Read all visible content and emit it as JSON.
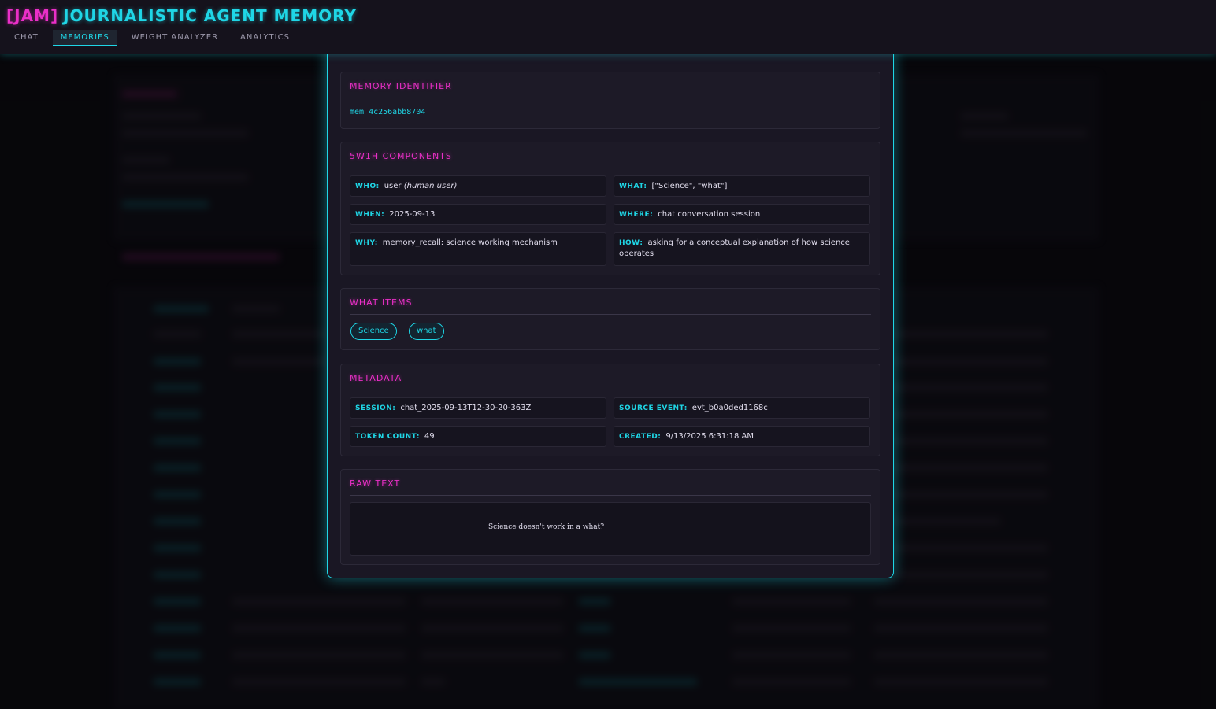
{
  "header": {
    "brand_tag": "[JAM]",
    "brand_name": "JOURNALISTIC AGENT MEMORY",
    "tabs": [
      {
        "label": "CHAT"
      },
      {
        "label": "MEMORIES"
      },
      {
        "label": "WEIGHT ANALYZER"
      },
      {
        "label": "ANALYTICS"
      }
    ],
    "active_tab": "MEMORIES"
  },
  "modal": {
    "identifier": {
      "title": "MEMORY IDENTIFIER",
      "value": "mem_4c256abb8704"
    },
    "components": {
      "title": "5W1H COMPONENTS",
      "who_label": "WHO:",
      "who_value": "user",
      "who_extra": "(human user)",
      "what_label": "WHAT:",
      "what_value": "[\"Science\", \"what\"]",
      "when_label": "WHEN:",
      "when_value": "2025-09-13",
      "where_label": "WHERE:",
      "where_value": "chat conversation session",
      "why_label": "WHY:",
      "why_value": "memory_recall: science working mechanism",
      "how_label": "HOW:",
      "how_value": "asking for a conceptual explanation of how science operates"
    },
    "what_items": {
      "title": "WHAT ITEMS",
      "items": [
        "Science",
        "what"
      ]
    },
    "metadata": {
      "title": "METADATA",
      "session_label": "SESSION:",
      "session_value": "chat_2025-09-13T12-30-20-363Z",
      "source_label": "SOURCE EVENT:",
      "source_value": "evt_b0a0ded1168c",
      "tokens_label": "TOKEN COUNT:",
      "tokens_value": "49",
      "created_label": "CREATED:",
      "created_value": "9/13/2025 6:31:18 AM"
    },
    "raw": {
      "title": "RAW TEXT",
      "text": "Science doesn't work in a what?"
    }
  },
  "colors": {
    "cyan": "#1fd6e6",
    "magenta": "#ea2fc7",
    "background": "#0b0a10",
    "panel": "#1a1724"
  }
}
